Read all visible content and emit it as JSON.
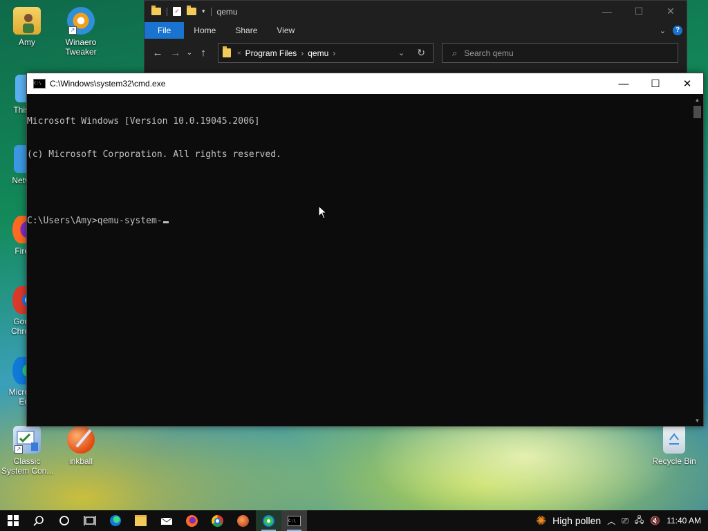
{
  "desktop_icons": [
    {
      "label": "Amy",
      "icon": "user-folder-icon"
    },
    {
      "label": "Winaero\nTweaker",
      "icon": "winaero-tweaker-icon"
    },
    {
      "label": "This",
      "icon": "this-pc-icon"
    },
    {
      "label": "Netv",
      "icon": "network-icon"
    },
    {
      "label": "Fire",
      "icon": "firefox-icon"
    },
    {
      "label": "Goo\nChro",
      "icon": "google-chrome-icon"
    },
    {
      "label": "Micro\nEd",
      "icon": "microsoft-edge-icon"
    },
    {
      "label": "Classic\nSystem Con...",
      "icon": "classic-control-panel-icon"
    },
    {
      "label": "inkball",
      "icon": "inkball-icon"
    },
    {
      "label": "Recycle Bin",
      "icon": "recycle-bin-icon"
    }
  ],
  "explorer": {
    "title": "qemu",
    "ribbon_tabs": [
      "File",
      "Home",
      "Share",
      "View"
    ],
    "breadcrumb": [
      "Program Files",
      "qemu"
    ],
    "search_placeholder": "Search qemu",
    "window_buttons": {
      "minimize": "—",
      "maximize": "☐",
      "close": "✕"
    }
  },
  "cmd": {
    "title": "C:\\Windows\\system32\\cmd.exe",
    "lines": [
      "Microsoft Windows [Version 10.0.19045.2006]",
      "(c) Microsoft Corporation. All rights reserved.",
      "",
      "C:\\Users\\Amy>qemu-system-"
    ],
    "window_buttons": {
      "minimize": "—",
      "maximize": "☐",
      "close": "✕"
    }
  },
  "taskbar": {
    "apps": [
      "start-icon",
      "search-icon",
      "cortana-icon",
      "task-view-icon",
      "edge-icon",
      "file-explorer-icon",
      "mail-icon",
      "firefox-icon",
      "chrome-icon",
      "app-icon",
      "winaero-icon",
      "cmd-icon"
    ],
    "weather_text": "High pollen",
    "time": "11:40 AM"
  },
  "colors": {
    "accent": "#1a73cf",
    "console_bg": "#0c0c0c",
    "console_fg": "#c0c0c0"
  }
}
